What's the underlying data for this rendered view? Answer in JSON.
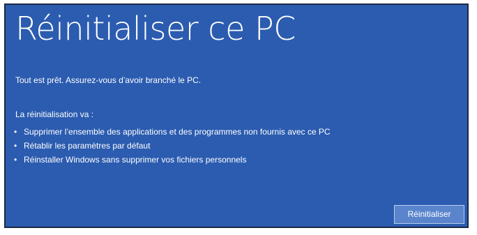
{
  "dialog": {
    "title": "Réinitialiser ce PC",
    "ready_text": "Tout est prêt. Assurez-vous d’avoir branché le PC.",
    "intro_text": "La réinitialisation va :",
    "bullets": [
      {
        "label": "Supprimer l’ensemble des applications et des programmes non fournis avec ce PC"
      },
      {
        "label": "Rétablir les paramètres par défaut"
      },
      {
        "label": "Réinstaller Windows sans supprimer vos fichiers personnels"
      }
    ],
    "bullet_glyph": "•",
    "action_button_label": "Réinitialiser"
  },
  "colors": {
    "background": "#2b5cb0",
    "button": "#5a84cc",
    "text": "#ffffff"
  }
}
